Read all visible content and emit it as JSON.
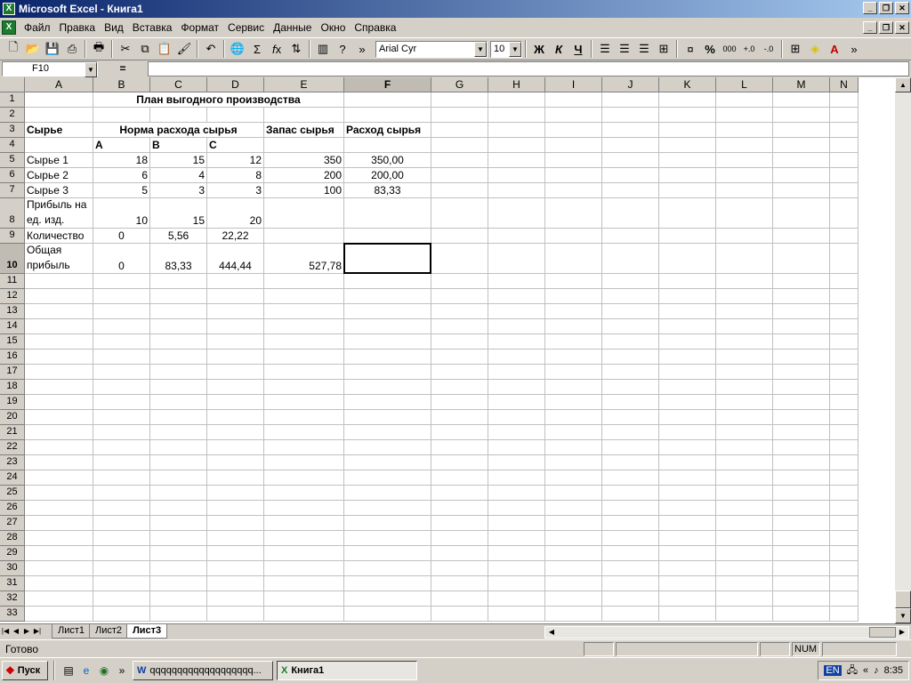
{
  "window": {
    "title": "Microsoft Excel - Книга1",
    "min": "_",
    "restore": "❐",
    "close": "✕"
  },
  "menu": [
    "Файл",
    "Правка",
    "Вид",
    "Вставка",
    "Формат",
    "Сервис",
    "Данные",
    "Окно",
    "Справка"
  ],
  "toolbar": {
    "font": "Arial Cyr",
    "size": "10",
    "bold": "Ж",
    "italic": "К",
    "underline": "Ч",
    "percent": "%",
    "thousands": "000"
  },
  "formula": {
    "namebox": "F10",
    "eq": "=",
    "value": ""
  },
  "columns": [
    "A",
    "B",
    "C",
    "D",
    "E",
    "F",
    "G",
    "H",
    "I",
    "J",
    "K",
    "L",
    "M",
    "N"
  ],
  "selected": {
    "col": "F",
    "row": "10"
  },
  "cells": {
    "title": "План выгодного производства",
    "r3": {
      "a": "Сырье",
      "b": "Норма расхода сырья",
      "e": "Запас сырья",
      "f": "Расход сырья"
    },
    "r4": {
      "b": "A",
      "c": "B",
      "d": "C"
    },
    "r5": {
      "a": "Сырье 1",
      "b": "18",
      "c": "15",
      "d": "12",
      "e": "350",
      "f": "350,00"
    },
    "r6": {
      "a": "Сырье 2",
      "b": "6",
      "c": "4",
      "d": "8",
      "e": "200",
      "f": "200,00"
    },
    "r7": {
      "a": "Сырье 3",
      "b": "5",
      "c": "3",
      "d": "3",
      "e": "100",
      "f": "83,33"
    },
    "r8": {
      "a1": "Прибыль на",
      "a2": "ед. изд.",
      "b": "10",
      "c": "15",
      "d": "20"
    },
    "r9": {
      "a": "Количество",
      "b": "0",
      "c": "5,56",
      "d": "22,22"
    },
    "r10": {
      "a1": "Общая",
      "a2": "прибыль",
      "b": "0",
      "c": "83,33",
      "d": "444,44",
      "e": "527,78"
    }
  },
  "sheets": [
    "Лист1",
    "Лист2",
    "Лист3"
  ],
  "status": {
    "ready": "Готово",
    "num": "NUM"
  },
  "taskbar": {
    "start": "Пуск",
    "task1": "qqqqqqqqqqqqqqqqqqq...",
    "task2": "Книга1",
    "lang": "EN",
    "time": "8:35"
  }
}
